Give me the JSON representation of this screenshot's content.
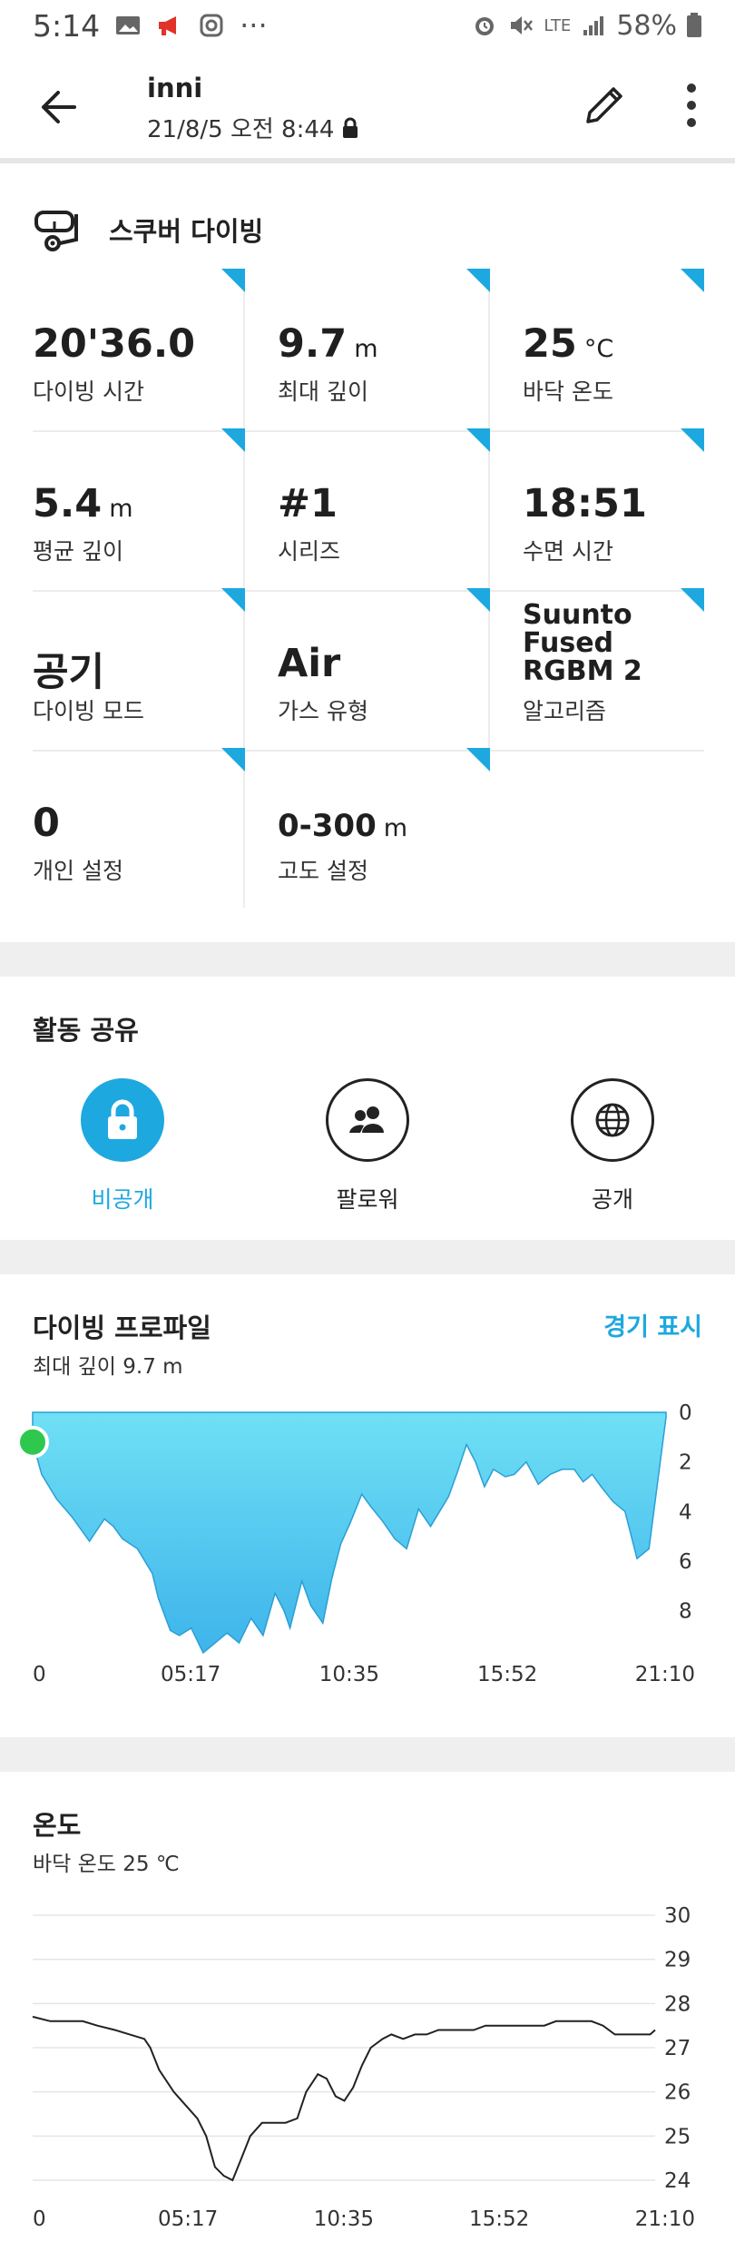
{
  "status_bar": {
    "time": "5:14",
    "dots": "···",
    "network": "LTE",
    "battery": "58%",
    "icons": [
      "gallery-icon",
      "megaphone-icon",
      "instagram-icon",
      "alarm-icon",
      "mute-icon",
      "signal-icon",
      "battery-icon"
    ]
  },
  "header": {
    "title": "inni",
    "subtitle": "21/8/5 오전 8:44"
  },
  "activity": {
    "sport": "스쿠버 다이빙",
    "stats": [
      {
        "value": "20'36.0",
        "unit": "",
        "label": "다이빙 시간"
      },
      {
        "value": "9.7",
        "unit": "m",
        "label": "최대 깊이"
      },
      {
        "value": "25",
        "unit": "°C",
        "label": "바닥 온도"
      },
      {
        "value": "5.4",
        "unit": "m",
        "label": "평균 깊이"
      },
      {
        "value": "#1",
        "unit": "",
        "label": "시리즈"
      },
      {
        "value": "18:51",
        "unit": "",
        "label": "수면 시간"
      },
      {
        "value": "공기",
        "unit": "",
        "label": "다이빙 모드"
      },
      {
        "value": "Air",
        "unit": "",
        "label": "가스 유형"
      },
      {
        "value": "Suunto Fused RGBM 2",
        "unit": "",
        "label": "알고리즘"
      },
      {
        "value": "0",
        "unit": "",
        "label": "개인 설정"
      },
      {
        "value": "0-300",
        "unit": "m",
        "label": "고도 설정"
      }
    ]
  },
  "share": {
    "title": "활동 공유",
    "options": [
      {
        "label": "비공개",
        "icon": "lock-icon",
        "selected": true
      },
      {
        "label": "팔로워",
        "icon": "followers-icon",
        "selected": false
      },
      {
        "label": "공개",
        "icon": "globe-icon",
        "selected": false
      }
    ]
  },
  "dive_profile": {
    "title": "다이빙 프로파일",
    "subtitle": "최대 깊이 9.7 m",
    "link": "경기 표시"
  },
  "temperature": {
    "title": "온도",
    "subtitle": "바닥 온도 25 ℃"
  },
  "colors": {
    "accent": "#1da8e0",
    "profile_fill_top": "#6fe0f5",
    "profile_fill_bottom": "#3eb4ea",
    "start_marker": "#2ec84f"
  },
  "chart_data": [
    {
      "type": "area",
      "title": "",
      "xlabel": "",
      "ylabel": "",
      "x_tick_labels": [
        "0",
        "05:17",
        "10:35",
        "15:52",
        "21:10"
      ],
      "y_tick_labels": [
        "0",
        "2",
        "4",
        "6",
        "8"
      ],
      "ylim": [
        0,
        9.7
      ],
      "y_inverted": true,
      "x_minutes": [
        0,
        0.3,
        0.8,
        1.3,
        1.9,
        2.4,
        2.7,
        3.0,
        3.5,
        4.0,
        4.2,
        4.6,
        4.9,
        5.3,
        5.7,
        6.1,
        6.5,
        6.9,
        7.3,
        7.7,
        8.1,
        8.4,
        8.6,
        9.0,
        9.3,
        9.7,
        10.0,
        10.3,
        10.6,
        11.0,
        11.3,
        11.7,
        12.1,
        12.5,
        12.9,
        13.3,
        13.6,
        13.9,
        14.2,
        14.5,
        14.8,
        15.1,
        15.4,
        15.8,
        16.1,
        16.5,
        16.9,
        17.3,
        17.7,
        18.1,
        18.4,
        18.7,
        19.0,
        19.4,
        19.8,
        20.2,
        20.6,
        21.17
      ],
      "depth_m": [
        1.2,
        2.5,
        3.5,
        4.2,
        5.2,
        4.3,
        4.6,
        5.1,
        5.5,
        6.5,
        7.5,
        8.8,
        9.0,
        8.7,
        9.7,
        9.3,
        8.9,
        9.3,
        8.3,
        9.0,
        7.3,
        8.0,
        8.7,
        6.8,
        7.8,
        8.5,
        6.7,
        5.3,
        4.5,
        3.3,
        3.8,
        4.4,
        5.1,
        5.5,
        3.9,
        4.6,
        4.0,
        3.4,
        2.4,
        1.3,
        2.0,
        3.0,
        2.3,
        2.6,
        2.5,
        2.0,
        2.9,
        2.5,
        2.3,
        2.3,
        2.8,
        2.5,
        3.0,
        3.6,
        4.0,
        5.9,
        5.5,
        0.2
      ]
    },
    {
      "type": "line",
      "title": "",
      "xlabel": "",
      "ylabel": "",
      "x_tick_labels": [
        "0",
        "05:17",
        "10:35",
        "15:52",
        "21:10"
      ],
      "y_tick_labels": [
        "30",
        "29",
        "28",
        "27",
        "26",
        "25",
        "24"
      ],
      "ylim": [
        23.9,
        30
      ],
      "x_minutes": [
        0,
        0.6,
        1.1,
        1.7,
        2.2,
        2.8,
        3.3,
        3.8,
        4.0,
        4.3,
        4.8,
        5.2,
        5.6,
        5.9,
        6.2,
        6.5,
        6.8,
        7.1,
        7.4,
        7.8,
        8.2,
        8.6,
        9.0,
        9.3,
        9.7,
        10.0,
        10.3,
        10.6,
        10.9,
        11.2,
        11.5,
        11.9,
        12.2,
        12.6,
        13.0,
        13.4,
        13.8,
        14.2,
        14.6,
        15.0,
        15.4,
        15.8,
        16.2,
        16.6,
        17.0,
        17.4,
        17.8,
        18.2,
        18.6,
        19.0,
        19.4,
        19.8,
        20.2,
        20.6,
        21.0,
        21.17
      ],
      "temp_c": [
        27.7,
        27.6,
        27.6,
        27.6,
        27.5,
        27.4,
        27.3,
        27.2,
        27.0,
        26.5,
        26.0,
        25.7,
        25.4,
        25.0,
        24.3,
        24.1,
        24.0,
        24.5,
        25.0,
        25.3,
        25.3,
        25.3,
        25.4,
        26.0,
        26.4,
        26.3,
        25.9,
        25.8,
        26.1,
        26.6,
        27.0,
        27.2,
        27.3,
        27.2,
        27.3,
        27.3,
        27.4,
        27.4,
        27.4,
        27.4,
        27.5,
        27.5,
        27.5,
        27.5,
        27.5,
        27.5,
        27.6,
        27.6,
        27.6,
        27.6,
        27.5,
        27.3,
        27.3,
        27.3,
        27.3,
        27.4
      ]
    }
  ]
}
